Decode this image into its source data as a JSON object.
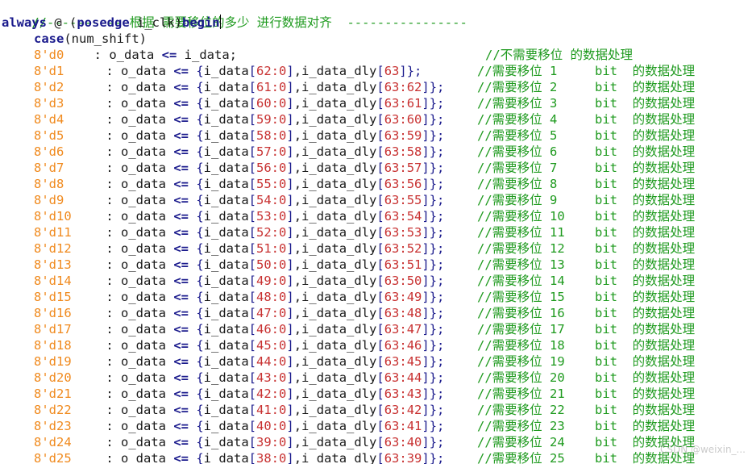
{
  "header_comment": "//---------- 根据 需要移位的多少 进行数据对齐  ----------------",
  "always_line": {
    "kw_always": "always",
    "at": " @ (",
    "kw_posedge": "posedge",
    "clk": " i_clk)",
    "kw_begin": "begin"
  },
  "case_line": {
    "kw_case": "case",
    "expr": "(num_shift)"
  },
  "first_case": {
    "label": "8'd0",
    "colon": "    : o_data ",
    "op": "<=",
    "rhs": " i_data;",
    "comment": "//不需要移位 的数据处理"
  },
  "cases": [
    {
      "label": "8'd1",
      "a": "62:0",
      "b": "63",
      "comment": "//需要移位 1     bit  的数据处理"
    },
    {
      "label": "8'd2",
      "a": "61:0",
      "b": "63:62",
      "comment": "//需要移位 2     bit  的数据处理"
    },
    {
      "label": "8'd3",
      "a": "60:0",
      "b": "63:61",
      "comment": "//需要移位 3     bit  的数据处理"
    },
    {
      "label": "8'd4",
      "a": "59:0",
      "b": "63:60",
      "comment": "//需要移位 4     bit  的数据处理"
    },
    {
      "label": "8'd5",
      "a": "58:0",
      "b": "63:59",
      "comment": "//需要移位 5     bit  的数据处理"
    },
    {
      "label": "8'd6",
      "a": "57:0",
      "b": "63:58",
      "comment": "//需要移位 6     bit  的数据处理"
    },
    {
      "label": "8'd7",
      "a": "56:0",
      "b": "63:57",
      "comment": "//需要移位 7     bit  的数据处理"
    },
    {
      "label": "8'd8",
      "a": "55:0",
      "b": "63:56",
      "comment": "//需要移位 8     bit  的数据处理"
    },
    {
      "label": "8'd9",
      "a": "54:0",
      "b": "63:55",
      "comment": "//需要移位 9     bit  的数据处理"
    },
    {
      "label": "8'd10",
      "a": "53:0",
      "b": "63:54",
      "comment": "//需要移位 10    bit  的数据处理"
    },
    {
      "label": "8'd11",
      "a": "52:0",
      "b": "63:53",
      "comment": "//需要移位 11    bit  的数据处理"
    },
    {
      "label": "8'd12",
      "a": "51:0",
      "b": "63:52",
      "comment": "//需要移位 12    bit  的数据处理"
    },
    {
      "label": "8'd13",
      "a": "50:0",
      "b": "63:51",
      "comment": "//需要移位 13    bit  的数据处理"
    },
    {
      "label": "8'd14",
      "a": "49:0",
      "b": "63:50",
      "comment": "//需要移位 14    bit  的数据处理"
    },
    {
      "label": "8'd15",
      "a": "48:0",
      "b": "63:49",
      "comment": "//需要移位 15    bit  的数据处理"
    },
    {
      "label": "8'd16",
      "a": "47:0",
      "b": "63:48",
      "comment": "//需要移位 16    bit  的数据处理"
    },
    {
      "label": "8'd17",
      "a": "46:0",
      "b": "63:47",
      "comment": "//需要移位 17    bit  的数据处理"
    },
    {
      "label": "8'd18",
      "a": "45:0",
      "b": "63:46",
      "comment": "//需要移位 18    bit  的数据处理"
    },
    {
      "label": "8'd19",
      "a": "44:0",
      "b": "63:45",
      "comment": "//需要移位 19    bit  的数据处理"
    },
    {
      "label": "8'd20",
      "a": "43:0",
      "b": "63:44",
      "comment": "//需要移位 20    bit  的数据处理"
    },
    {
      "label": "8'd21",
      "a": "42:0",
      "b": "63:43",
      "comment": "//需要移位 21    bit  的数据处理"
    },
    {
      "label": "8'd22",
      "a": "41:0",
      "b": "63:42",
      "comment": "//需要移位 22    bit  的数据处理"
    },
    {
      "label": "8'd23",
      "a": "40:0",
      "b": "63:41",
      "comment": "//需要移位 23    bit  的数据处理"
    },
    {
      "label": "8'd24",
      "a": "39:0",
      "b": "63:40",
      "comment": "//需要移位 24    bit  的数据处理"
    },
    {
      "label": "8'd25",
      "a": "38:0",
      "b": "63:39",
      "comment": "//需要移位 25    bit  的数据处理"
    }
  ],
  "tokens": {
    "colon": " : o_data ",
    "op": "<=",
    "open": " {",
    "idata": "i_data",
    "lb": "[",
    "rb": "]",
    "comma": ",",
    "idly": "i_data_dly",
    "close": "};"
  },
  "watermark": "CSDN @weixin_..."
}
